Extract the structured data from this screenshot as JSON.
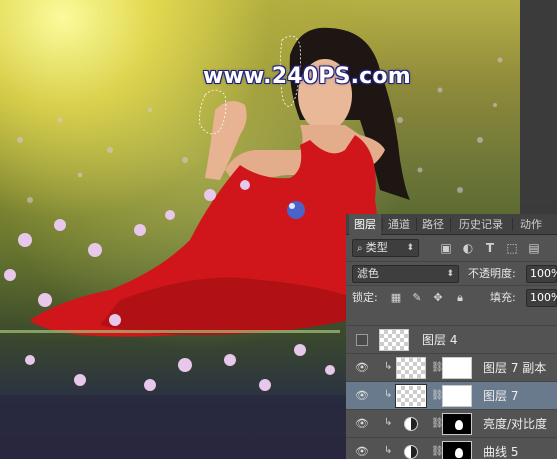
{
  "watermark": {
    "text": "www.240PS.com"
  },
  "panel": {
    "tabs": [
      {
        "label": "图层",
        "active": true
      },
      {
        "label": "通道",
        "active": false
      },
      {
        "label": "路径",
        "active": false
      },
      {
        "label": "历史记录",
        "active": false
      },
      {
        "label": "动作",
        "active": false
      }
    ],
    "filter": {
      "kind_label": "类型"
    },
    "blend": {
      "mode": "滤色",
      "opacity_label": "不透明度:",
      "opacity_value": "100%"
    },
    "lock": {
      "label": "锁定:",
      "fill_label": "填充:",
      "fill_value": "100%"
    },
    "layers": [
      {
        "name": "图层 4",
        "visible": false,
        "clipped": false,
        "has_mask": false,
        "selected": false
      },
      {
        "name": "图层 7 副本",
        "visible": true,
        "clipped": true,
        "has_mask": true,
        "selected": false
      },
      {
        "name": "图层 7",
        "visible": true,
        "clipped": true,
        "has_mask": true,
        "selected": true
      },
      {
        "name": "亮度/对比度",
        "visible": true,
        "clipped": true,
        "has_mask": true,
        "selected": false
      },
      {
        "name": "曲线 5",
        "visible": true,
        "clipped": true,
        "has_mask": true,
        "selected": false
      }
    ]
  },
  "colors": {
    "panel_bg": "#535353",
    "selected_row": "#697a8c",
    "accent_red": "#d21a1a"
  }
}
